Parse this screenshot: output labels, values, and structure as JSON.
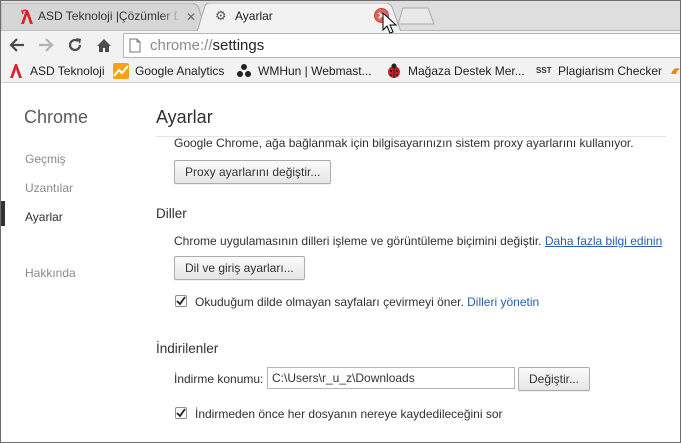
{
  "browser": {
    "tabs": [
      {
        "title": "ASD Teknoloji |Çözümler D",
        "close": "✕"
      },
      {
        "title": "Ayarlar"
      }
    ],
    "omnibox": {
      "scheme": "chrome://",
      "host": "settings"
    },
    "bookmarks": [
      {
        "label": "ASD Teknoloji"
      },
      {
        "label": "Google Analytics"
      },
      {
        "label": "WMHun | Webmast..."
      },
      {
        "label": "Mağaza Destek Mer..."
      },
      {
        "label": "Plagiarism Checker",
        "icon_text": "SST"
      }
    ],
    "colors": {
      "accent_red": "#d9232d",
      "close_hover": "#e0645f",
      "link": "#2a5db0"
    }
  },
  "sidebar": {
    "title": "Chrome",
    "items": [
      {
        "label": "Geçmiş"
      },
      {
        "label": "Uzantılar"
      },
      {
        "label": "Ayarlar",
        "active": true
      },
      {
        "label": "Hakkında"
      }
    ]
  },
  "main": {
    "title": "Ayarlar",
    "proxy": {
      "description": "Google Chrome, ağa bağlanmak için bilgisayarınızın sistem proxy ayarlarını kullanıyor.",
      "button": "Proxy ayarlarını değiştir..."
    },
    "languages": {
      "heading": "Diller",
      "description": "Chrome uygulamasının dilleri işleme ve görüntüleme biçimini değiştir.",
      "learn_more": "Daha fazla bilgi edinin",
      "button": "Dil ve giriş ayarları...",
      "translate_checkbox": {
        "checked": true,
        "label": "Okuduğum dilde olmayan sayfaları çevirmeyi öner.",
        "link": "Dilleri yönetin"
      }
    },
    "downloads": {
      "heading": "İndirilenler",
      "location_label": "İndirme konumu:",
      "location_value": "C:\\Users\\r_u_z\\Downloads",
      "change_button": "Değiştir...",
      "ask_checkbox": {
        "checked": true,
        "label": "İndirmeden önce her dosyanın nereye kaydedileceğini sor"
      }
    }
  }
}
